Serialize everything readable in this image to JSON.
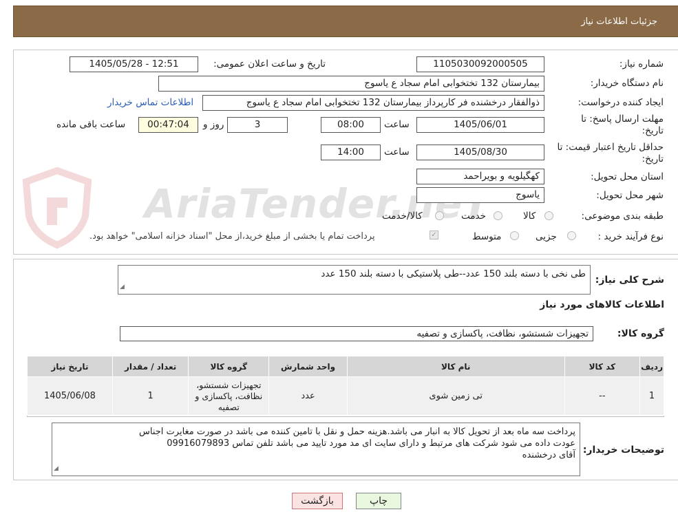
{
  "header": {
    "title": "جزئیات اطلاعات نیاز"
  },
  "need_number": {
    "label": "شماره نیاز:",
    "value": "1105030092000505"
  },
  "announce_date": {
    "label": "تاریخ و ساعت اعلان عمومی:",
    "value": "1405/05/28 - 12:51"
  },
  "buyer_org": {
    "label": "نام دستگاه خریدار:",
    "value": "بیمارستان 132 تختخوابی امام سجاد  ع  یاسوج"
  },
  "requester": {
    "label": "ایجاد کننده درخواست:",
    "value": "ذوالفقار درخشنده فر کارپرداز بیمارستان 132 تختخوابی امام سجاد  ع  یاسوج",
    "contact_link": "اطلاعات تماس خریدار"
  },
  "reply_deadline": {
    "label": "مهلت ارسال پاسخ: تا تاریخ:",
    "date": "1405/06/01",
    "time_label": "ساعت",
    "time": "08:00",
    "days": "3",
    "days_label": "روز و",
    "remaining": "00:47:04",
    "remaining_label": "ساعت باقی مانده"
  },
  "price_validity": {
    "label": "حداقل تاریخ اعتبار قیمت: تا تاریخ:",
    "date": "1405/08/30",
    "time_label": "ساعت",
    "time": "14:00"
  },
  "province": {
    "label": "استان محل تحویل:",
    "value": "کهگیلویه و بویراحمد"
  },
  "city": {
    "label": "شهر محل تحویل:",
    "value": "یاسوج"
  },
  "category": {
    "label": "طبقه بندی موضوعی:",
    "options": [
      "کالا",
      "خدمت",
      "کالا/خدمت"
    ]
  },
  "process": {
    "label": "نوع فرآیند خرید :",
    "options": [
      "جزیی",
      "متوسط"
    ],
    "note": "پرداخت تمام یا بخشی از مبلغ خرید،از محل \"اسناد خزانه اسلامی\" خواهد بود."
  },
  "description": {
    "label": "شرح کلی نیاز:",
    "value": "طی نخی با دسته بلند 150 عدد--طی پلاستیکی با دسته بلند 150 عدد"
  },
  "items_section": {
    "title": "اطلاعات کالاهای مورد نیاز"
  },
  "goods_group": {
    "label": "گروه کالا:",
    "value": "تجهیزات شستشو، نظافت، پاکسازی و تصفیه"
  },
  "table": {
    "headers": [
      "ردیف",
      "کد کالا",
      "نام کالا",
      "واحد شمارش",
      "گروه کالا",
      "تعداد / مقدار",
      "تاریخ نیاز"
    ],
    "rows": [
      [
        "1",
        "--",
        "تی زمین شوی",
        "عدد",
        "تجهیزات شستشو، نظافت، پاکسازی و تصفیه",
        "1",
        "1405/06/08"
      ]
    ]
  },
  "buyer_notes": {
    "label": "توضیحات خریدار:",
    "line1": "پرداخت سه ماه بعد از تحویل کالا به انبار می باشد.هزینه حمل و نقل با تامین کننده می باشد در صورت مغایرت اجناس",
    "line2": "عودت داده می شود شرکت های مرتبط و دارای سایت ای مد مورد تایید می باشد تلفن تماس 09916079893",
    "line3": " آقای درخشنده"
  },
  "buttons": {
    "print": "چاپ",
    "back": "بازگشت"
  },
  "watermark": "AriaTender.neT"
}
